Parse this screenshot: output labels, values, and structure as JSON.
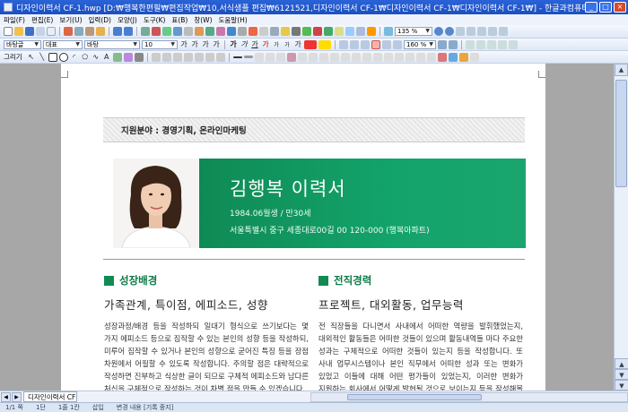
{
  "window": {
    "title": "디자인이력서 CF-1.hwp [D:₩행복한편필₩편집작업₩10,서식샘플 편집₩6121521,디자인이력서 CF-1₩디자인이력서 CF-1₩디자인이력서 CF-1₩] - 한글과컴퓨터 한글",
    "min": "_",
    "max": "□",
    "close": "×"
  },
  "menu": [
    "파일(F)",
    "편집(E)",
    "보기(U)",
    "입력(D)",
    "모양(J)",
    "도구(K)",
    "표(B)",
    "창(W)",
    "도움말(H)"
  ],
  "toolbar": {
    "zoom": "135 %",
    "style": "바탕글",
    "font_lang": "대표",
    "font": "바탕",
    "size": "10",
    "line_spacing": "160 %",
    "draw_label": "그리기"
  },
  "document": {
    "field": "지원분야 : 경영기획, 온라인마케팅",
    "name": "김행복 이력서",
    "birth": "1984.06월생 / 만30세",
    "address": "서울특별시 중구 세종대로00길 00 120-000 (행복아파트)",
    "left": {
      "heading": "성장배경",
      "subheading": "가족관계, 특이점, 에피소드, 성향",
      "body": "성장과정/배경 등을 작성하되 일대기 형식으로 쓰기보다는 몇 가지 에피소드 등으로 짐작할 수 있는 본인의 성향 등을 작성하되, 미루어 짐작할 수 있거나 본인의 성향으로 굳어진 특징 등을 장점 차원에서 어필할 수 있도록 작성합니다. 주의할 점은 대략적으로 작성하면 진부하고 식상한 글이 되므로 구체적 에피소드와 남다른 처신을 구체적으로 작성하는 것이 차별 점을 만들 수 있겠습니다."
    },
    "right": {
      "heading": "전직경력",
      "subheading": "프로젝트, 대외활동, 업무능력",
      "body": "전 직장들을 다니면서 사내에서 어떠한 역량을 발휘했었는지, 대외적인 활동들은 어떠한 것들이 있으며 활동내역들 마다 주요한 성과는 구체적으로 어떠한 것들이 있는지 등을 작성합니다. 또 사내 업무시스템이나 본인 직무에서 어떠한 성과 또는 변화가 있었고 이들에 대해 어떤 평가들이 있었는지, 이러한 변화가 지원하는 회사에서 어떻게 발현될 것으로 보이는지 등을 작성해볼 수 있겠습니다."
    }
  },
  "statusbar": {
    "doc_tab": "디자인이력서 CF-1",
    "page": "1/1 쪽",
    "section": "1단",
    "line": "1줄 1칸",
    "mode": "삽입",
    "track": "변경 내용 [기록 중지]"
  },
  "colors": {
    "accent_green": "#13a46b",
    "heading_green": "#0c7a47",
    "titlebar_blue": "#2a63d8"
  }
}
